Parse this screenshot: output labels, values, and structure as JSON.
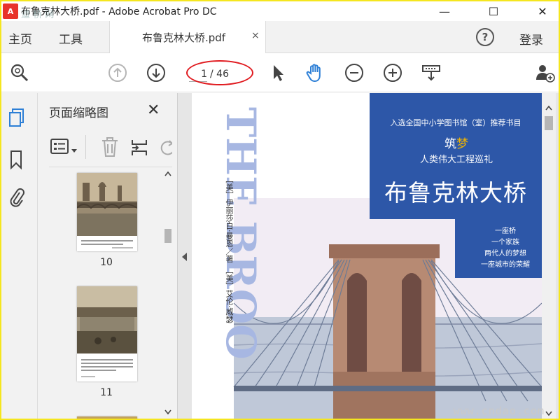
{
  "window": {
    "title": "布鲁克林大桥.pdf - Adobe Acrobat Pro DC",
    "app_icon": "acrobat-icon",
    "watermark_logo": "道 桥 网"
  },
  "menu": {
    "home": "主页",
    "tools": "工具",
    "help": "?",
    "login": "登录"
  },
  "tab": {
    "label": "布鲁克林大桥.pdf",
    "close": "×"
  },
  "toolbar": {
    "page_current": "1",
    "page_total": "/ 46",
    "icons": [
      "search-zoom-icon",
      "previous-page-icon",
      "next-page-icon",
      "select-cursor-icon",
      "hand-tool-icon",
      "zoom-out-icon",
      "zoom-in-icon",
      "print-production-icon",
      "share-user-icon"
    ]
  },
  "thumbnails": {
    "title": "页面缩略图",
    "close": "✕",
    "pages": [
      {
        "label": "10"
      },
      {
        "label": "11"
      }
    ]
  },
  "cover": {
    "recommend": "入选全国中小学图书馆（室）推荐书目",
    "dream_prefix": "筑",
    "dream_word": "梦",
    "series": "人类伟大工程巡礼",
    "title": "布鲁克林大桥",
    "taglines": [
      "一座桥",
      "一个家族",
      "两代人的梦想",
      "一座城市的荣耀"
    ],
    "author": "［美］伊丽莎白·曼恩／著　［美］艾伦·威瑟",
    "english_title": "THE BROO"
  },
  "watermark": "www.cndao.com",
  "colors": {
    "accent_blue": "#2d57a8",
    "annotation_red": "#e0191e",
    "hand_tool_blue": "#2d7fd6",
    "frame_yellow": "#f5e61e"
  }
}
